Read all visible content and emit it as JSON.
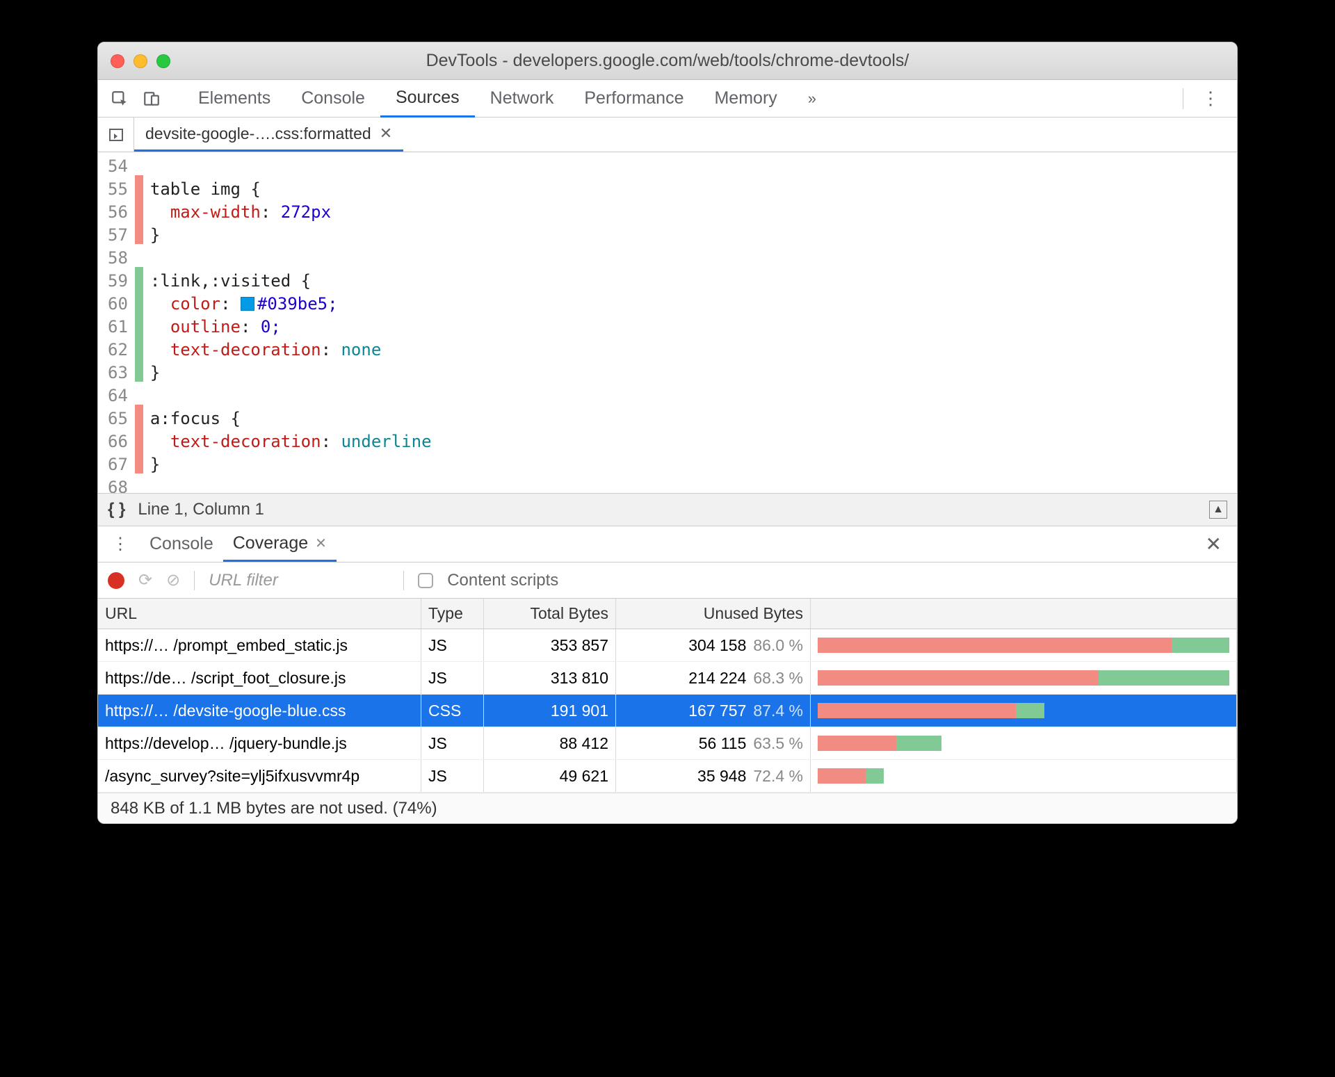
{
  "window": {
    "title": "DevTools - developers.google.com/web/tools/chrome-devtools/"
  },
  "main_tabs": {
    "items": [
      "Elements",
      "Console",
      "Sources",
      "Network",
      "Performance",
      "Memory"
    ],
    "active_index": 2,
    "overflow_glyph": "»"
  },
  "file_tab": {
    "label": "devsite-google-….css:formatted"
  },
  "editor": {
    "status": "Line 1, Column 1",
    "first_line_number": 54,
    "lines": [
      {
        "n": 54,
        "cov": "none",
        "raw": ""
      },
      {
        "n": 55,
        "cov": "red",
        "sel": "table img",
        "open": "{"
      },
      {
        "n": 56,
        "cov": "red",
        "prop": "max-width",
        "val": "272px"
      },
      {
        "n": 57,
        "cov": "red",
        "close": "}"
      },
      {
        "n": 58,
        "cov": "none",
        "raw": ""
      },
      {
        "n": 59,
        "cov": "green",
        "sel": ":link,:visited",
        "open": "{"
      },
      {
        "n": 60,
        "cov": "green",
        "prop": "color",
        "colorswatch": "#039be5",
        "val": "#039be5;"
      },
      {
        "n": 61,
        "cov": "green",
        "prop": "outline",
        "val": "0;"
      },
      {
        "n": 62,
        "cov": "green",
        "prop": "text-decoration",
        "kw": "none"
      },
      {
        "n": 63,
        "cov": "green",
        "close": "}"
      },
      {
        "n": 64,
        "cov": "none",
        "raw": ""
      },
      {
        "n": 65,
        "cov": "red",
        "sel": "a:focus",
        "open": "{"
      },
      {
        "n": 66,
        "cov": "red",
        "prop": "text-decoration",
        "kw": "underline"
      },
      {
        "n": 67,
        "cov": "red",
        "close": "}"
      },
      {
        "n": 68,
        "cov": "none",
        "raw": ""
      }
    ]
  },
  "drawer": {
    "tabs": [
      "Console",
      "Coverage"
    ],
    "active_index": 1
  },
  "coverage": {
    "url_filter_placeholder": "URL filter",
    "content_scripts_label": "Content scripts",
    "headers": {
      "url": "URL",
      "type": "Type",
      "total": "Total Bytes",
      "unused": "Unused Bytes"
    },
    "rows": [
      {
        "url": "https://… /prompt_embed_static.js",
        "type": "JS",
        "total": "353 857",
        "unused": "304 158",
        "pct": "86.0 %",
        "unused_frac": 0.86
      },
      {
        "url": "https://de… /script_foot_closure.js",
        "type": "JS",
        "total": "313 810",
        "unused": "214 224",
        "pct": "68.3 %",
        "unused_frac": 0.683
      },
      {
        "url": "https://… /devsite-google-blue.css",
        "type": "CSS",
        "total": "191 901",
        "unused": "167 757",
        "pct": "87.4 %",
        "unused_frac": 0.874,
        "selected": true
      },
      {
        "url": "https://develop… /jquery-bundle.js",
        "type": "JS",
        "total": "88 412",
        "unused": "56 115",
        "pct": "63.5 %",
        "unused_frac": 0.635
      },
      {
        "url": "/async_survey?site=ylj5ifxusvvmr4p",
        "type": "JS",
        "total": "49 621",
        "unused": "35 948",
        "pct": "72.4 %",
        "unused_frac": 0.724
      }
    ],
    "footer": "848 KB of 1.1 MB bytes are not used. (74%)"
  }
}
